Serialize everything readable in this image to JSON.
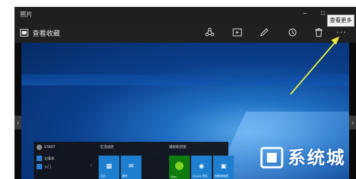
{
  "window": {
    "title": "照片"
  },
  "toolbar": {
    "collection_label": "查看收藏",
    "more_label": "···",
    "tooltip": "查看更多"
  },
  "start_menu": {
    "user": "START",
    "apps": [
      "记事本",
      "入门"
    ],
    "group1": "生活动态",
    "group2": "播放和浏览",
    "tiles": [
      "日历",
      "邮件",
      "Xbox",
      "Groove 音乐",
      "电影和电视"
    ]
  },
  "watermark": {
    "text": "系统城"
  },
  "colors": {
    "arrow": "#e8f03c",
    "accent": "#1e7fd0",
    "window_bg": "#1b1b1b"
  }
}
